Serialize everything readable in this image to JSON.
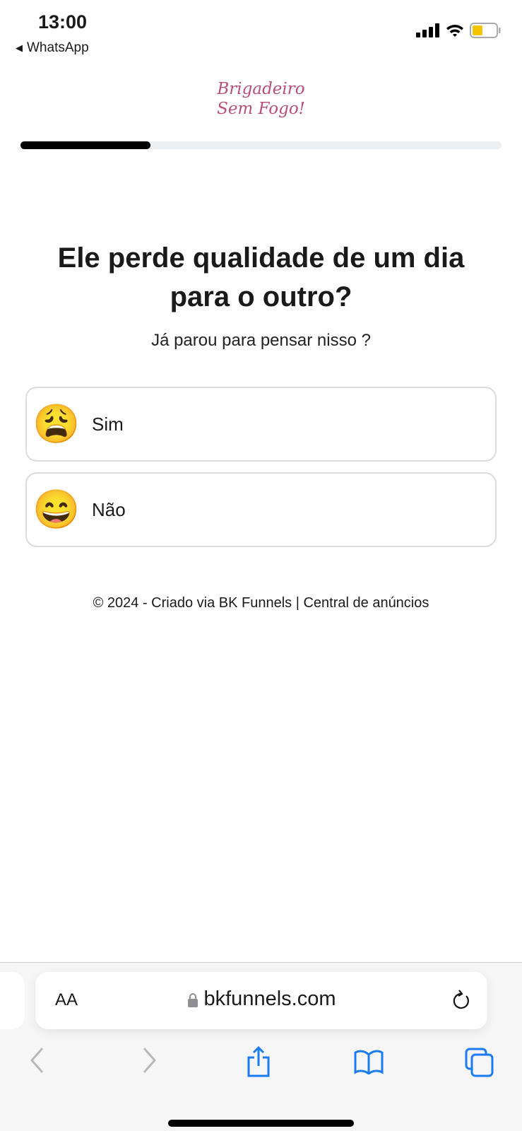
{
  "status": {
    "time": "13:00",
    "back_app": "WhatsApp",
    "battery_color": "#f5c400"
  },
  "logo": {
    "line1": "Brigadeiro",
    "line2": "Sem Fogo!",
    "color": "#b84f77"
  },
  "progress": {
    "percent": 27
  },
  "question": {
    "title": "Ele perde qualidade de um dia para o outro?",
    "subtitle": "Já parou para pensar nisso ?"
  },
  "options": [
    {
      "emoji": "😩",
      "label": "Sim"
    },
    {
      "emoji": "😄",
      "label": "Não"
    }
  ],
  "footer": {
    "left": "© 2024 - Criado via BK Funnels",
    "sep": "|",
    "right": "Central de anúncios"
  },
  "browser": {
    "aa": "AA",
    "url": "bkfunnels.com",
    "accent": "#1a7cf0"
  }
}
